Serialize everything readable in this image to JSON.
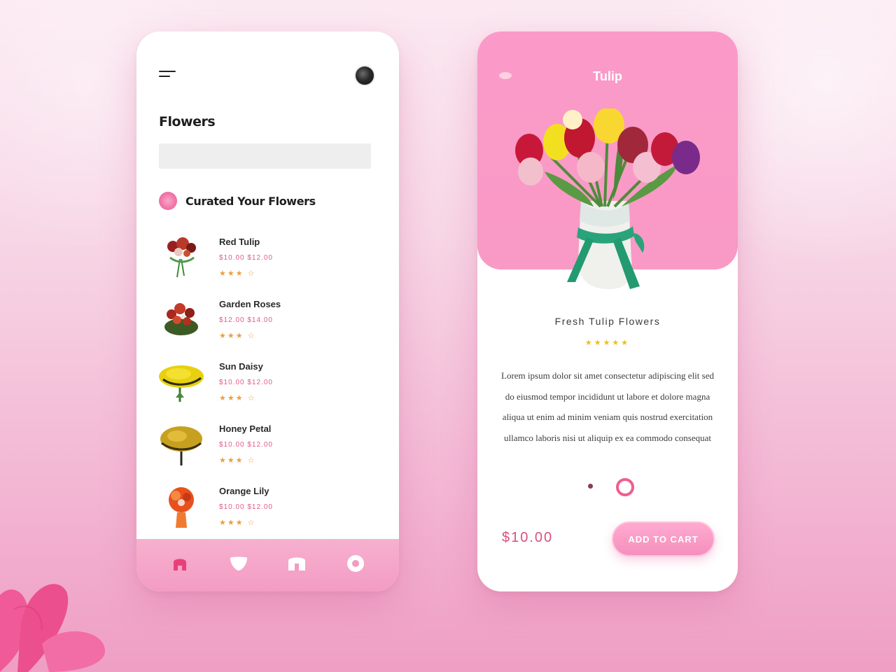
{
  "colors": {
    "accent_pink": "#f999c6",
    "price_pink": "#e05a8a",
    "star_yellow": "#e7c020"
  },
  "list_screen": {
    "title": "Flowers",
    "search": {
      "placeholder": ""
    },
    "section_title": "Curated Your Flowers",
    "items": [
      {
        "name": "Red Tulip",
        "price": "$10.00 $12.00",
        "rating": "★★★ ☆",
        "icon": "red-bouquet-thumb"
      },
      {
        "name": "Garden Roses",
        "price": "$12.00 $14.00",
        "rating": "★★★ ☆",
        "icon": "rose-bouquet-thumb"
      },
      {
        "name": "Sun Daisy",
        "price": "$10.00 $12.00",
        "rating": "★★★ ☆",
        "icon": "yellow-bouquet-thumb"
      },
      {
        "name": "Honey Petal",
        "price": "$10.00 $12.00",
        "rating": "★★★ ☆",
        "icon": "amber-bouquet-thumb"
      },
      {
        "name": "Orange Lily",
        "price": "$10.00 $12.00",
        "rating": "★★★ ☆",
        "icon": "orange-bouquet-thumb"
      }
    ],
    "bottom_nav": [
      {
        "icon": "home-icon"
      },
      {
        "icon": "favorites-icon"
      },
      {
        "icon": "bag-icon"
      },
      {
        "icon": "profile-icon"
      }
    ]
  },
  "detail_screen": {
    "header_title": "Tulip",
    "product_name": "Fresh Tulip Flowers",
    "rating": "★★★★★",
    "description": "Lorem ipsum dolor sit amet consectetur adipiscing elit sed do eiusmod tempor incididunt ut labore et dolore magna aliqua ut enim ad minim veniam quis nostrud exercitation ullamco laboris nisi ut aliquip ex ea commodo consequat",
    "price": "$10.00",
    "cart_label": "ADD TO CART"
  }
}
